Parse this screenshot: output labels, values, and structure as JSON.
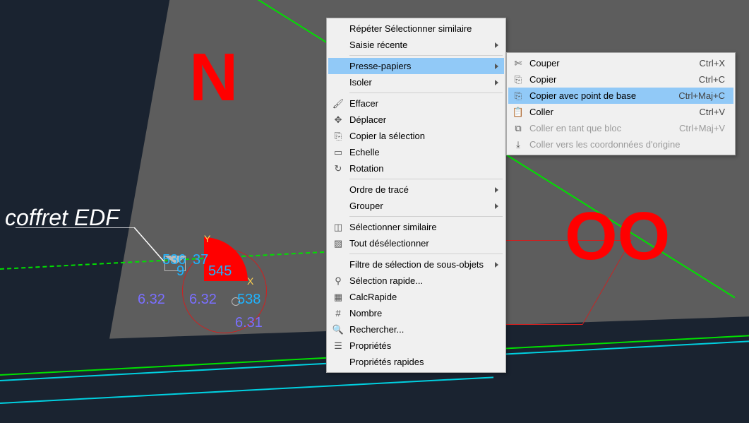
{
  "canvas": {
    "label_coffret": "coffret EDF",
    "red_letter_north": "N",
    "red_letter_fragment": "OO",
    "axis_x": "X",
    "axis_y": "Y",
    "points": {
      "p536": "536",
      "p537": "37",
      "p9": "9",
      "p545": "545",
      "p538": "538",
      "v632a": "6.32",
      "v632b": "6.32",
      "v631": "6.31"
    }
  },
  "context_menu": {
    "repeat": "Répéter Sélectionner similaire",
    "recent_input": "Saisie récente",
    "clipboard": "Presse-papiers",
    "isolate": "Isoler",
    "erase": "Effacer",
    "move": "Déplacer",
    "copy_sel": "Copier la sélection",
    "scale": "Echelle",
    "rotate": "Rotation",
    "draw_order": "Ordre de tracé",
    "group": "Grouper",
    "select_similar": "Sélectionner similaire",
    "deselect_all": "Tout désélectionner",
    "subobj_filter": "Filtre de sélection de sous-objets",
    "quick_select": "Sélection rapide...",
    "quickcalc": "CalcRapide",
    "count": "Nombre",
    "find": "Rechercher...",
    "properties": "Propriétés",
    "quick_props": "Propriétés rapides"
  },
  "clipboard_menu": {
    "cut": {
      "label": "Couper",
      "shortcut": "Ctrl+X"
    },
    "copy": {
      "label": "Copier",
      "shortcut": "Ctrl+C"
    },
    "copy_base": {
      "label": "Copier avec point de base",
      "shortcut": "Ctrl+Maj+C"
    },
    "paste": {
      "label": "Coller",
      "shortcut": "Ctrl+V"
    },
    "paste_block": {
      "label": "Coller en tant que bloc",
      "shortcut": "Ctrl+Maj+V"
    },
    "paste_orig": {
      "label": "Coller vers les coordonnées d'origine",
      "shortcut": ""
    }
  }
}
